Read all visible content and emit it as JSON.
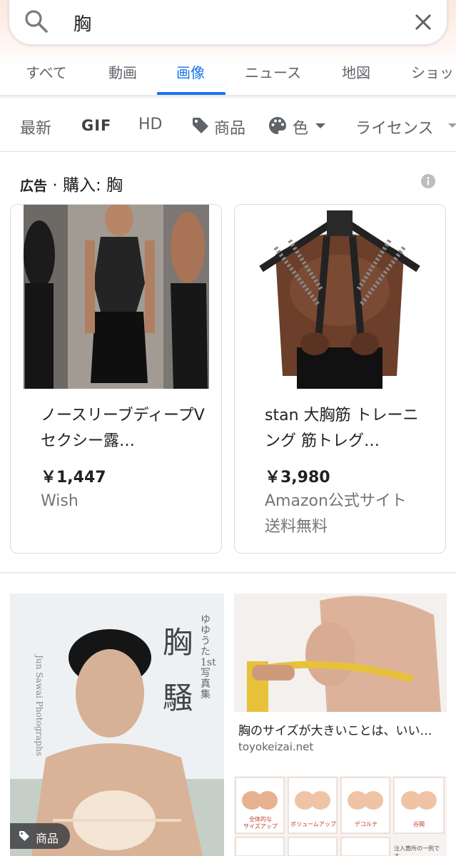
{
  "search": {
    "query": "胸"
  },
  "tabs": [
    {
      "label": "すべて"
    },
    {
      "label": "動画"
    },
    {
      "label": "画像",
      "active": true
    },
    {
      "label": "ニュース"
    },
    {
      "label": "地図"
    },
    {
      "label": "ショッ"
    }
  ],
  "filters": {
    "latest": "最新",
    "gif": "GIF",
    "hd": "HD",
    "products": "商品",
    "color": "色",
    "license": "ライセンス"
  },
  "ad": {
    "label": "広告",
    "separator": "·",
    "title": "購入: 胸"
  },
  "products": [
    {
      "title": "ノースリーブディープVセクシー露…",
      "price": "￥1,447",
      "merchant": "Wish",
      "shipping": ""
    },
    {
      "title": "stan 大胸筋 トレーニング 筋トレグ…",
      "price": "￥3,980",
      "merchant": "Amazon公式サイト",
      "shipping": "送料無料"
    }
  ],
  "results": {
    "left_badge": "商品",
    "right_title": "胸のサイズが大きいことは、いい…",
    "right_domain": "toyokeizai.net",
    "left_image_text": {
      "kanji": "胸\n騒",
      "vertical_sub": "ゆゆうた1st写真集",
      "vertical_en": "Jun Sawai Photographs"
    },
    "diagram_labels": [
      "全体的な\nサイズアップ",
      "ボリュームアップ",
      "デコルテ",
      "谷間",
      "注入箇所の一例です。"
    ]
  },
  "colors": {
    "accent": "#1a73e8",
    "text_primary": "#202124",
    "text_secondary": "#5f6368",
    "divider": "#dadce0"
  },
  "icons": [
    "search-icon",
    "close-icon",
    "tag-icon",
    "palette-icon",
    "info-icon"
  ]
}
